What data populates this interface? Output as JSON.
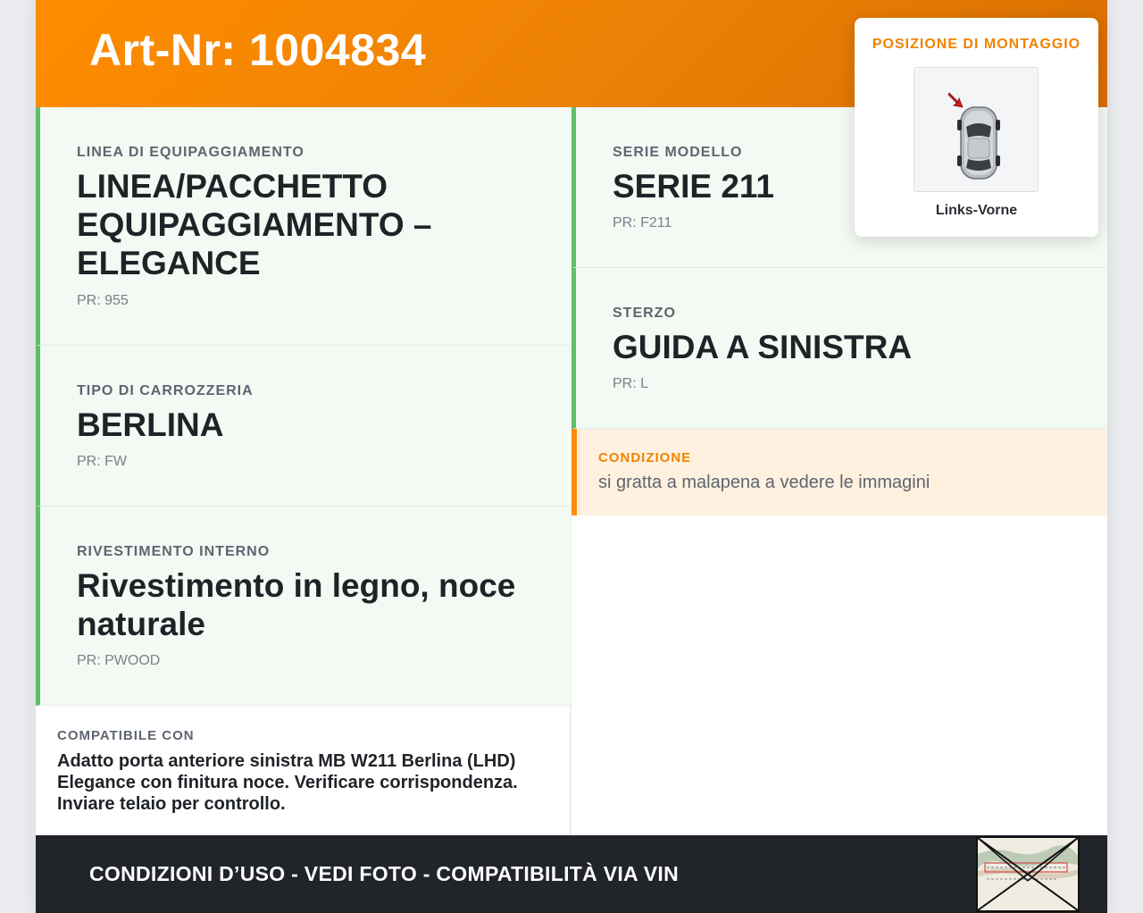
{
  "header": {
    "title": "Art-Nr: 1004834"
  },
  "fields": [
    {
      "label": "LINEA DI EQUIPAGGIAMENTO",
      "value": "LINEA/PACCHETTO EQUIPAGGIAMENTO – ELEGANCE",
      "pr": "PR: 955"
    },
    {
      "label": "TIPO DI CARROZZERIA",
      "value": "BERLINA",
      "pr": "PR: FW"
    },
    {
      "label": "RIVESTIMENTO INTERNO",
      "value": "Rivestimento in legno, noce naturale",
      "pr": "PR: PWOOD"
    },
    {
      "label": "SERIE MODELLO",
      "value": "SERIE 211",
      "pr": "PR: F211"
    },
    {
      "label": "STERZO",
      "value": "GUIDA A SINISTRA",
      "pr": "PR: L"
    }
  ],
  "condition": {
    "label": "CONDIZIONE",
    "text": "si gratta a malapena a vedere le immagini"
  },
  "compat": {
    "label": "COMPATIBILE CON",
    "text": "Adatto porta anteriore sinistra MB W211 Berlina (LHD) Elegance con finitura noce. Verificare corrispondenza. Inviare telaio per controllo."
  },
  "footer": {
    "text": "CONDIZIONI D’USO - VEDI FOTO - COMPATIBILITÀ VIA VIN"
  },
  "mount": {
    "title": "POSIZIONE DI MONTAGGIO",
    "position": "Links-Vorne"
  },
  "colors": {
    "accent": "#ff8c00",
    "green": "#5fbf6a",
    "dark": "#212429",
    "cell_bg": "#f3f9f3"
  }
}
